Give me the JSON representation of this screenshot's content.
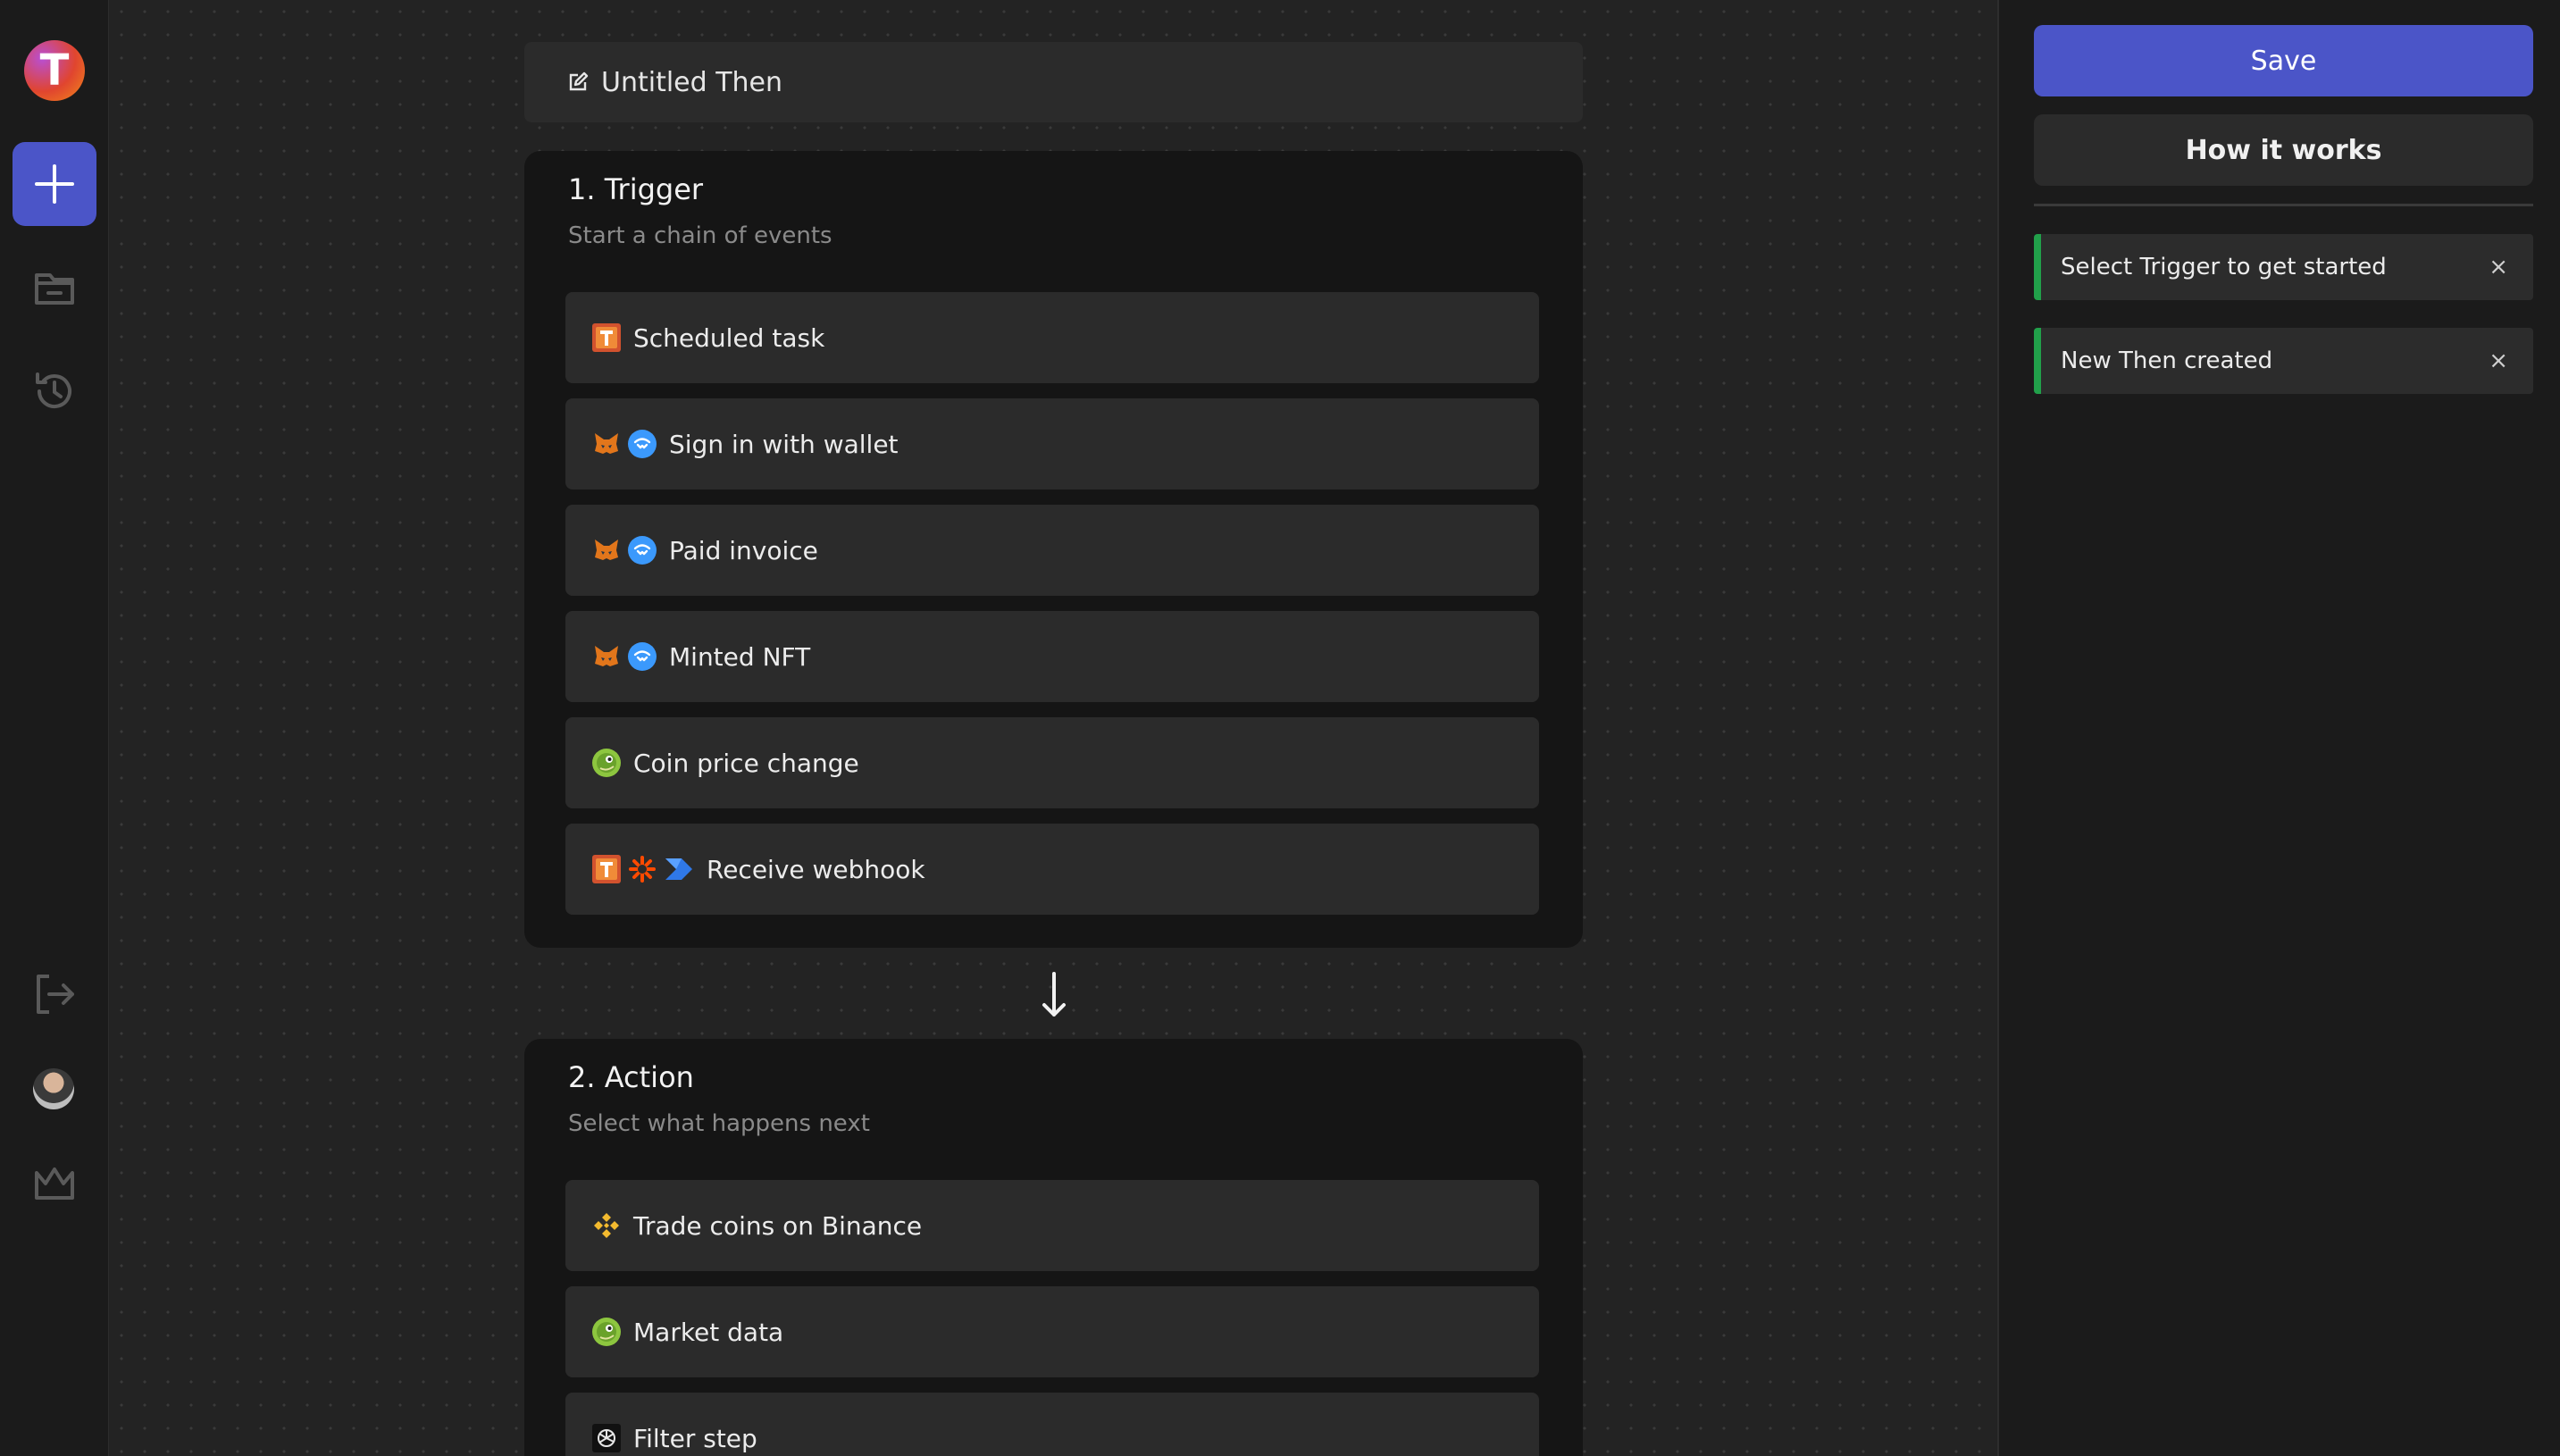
{
  "sidebar": {
    "logo_letter": "T",
    "items": [
      "add-icon",
      "folder-icon",
      "history-icon",
      "logout-icon",
      "avatar",
      "crown-icon"
    ]
  },
  "editor": {
    "title": "Untitled Then",
    "trigger": {
      "title": "1. Trigger",
      "subtitle": "Start a chain of events",
      "options": [
        {
          "label": "Scheduled task",
          "icons": [
            "then-logo"
          ]
        },
        {
          "label": "Sign in with wallet",
          "icons": [
            "metamask-fox-icon",
            "walletconnect-icon"
          ]
        },
        {
          "label": "Paid invoice",
          "icons": [
            "metamask-fox-icon",
            "walletconnect-icon"
          ]
        },
        {
          "label": "Minted NFT",
          "icons": [
            "metamask-fox-icon",
            "walletconnect-icon"
          ]
        },
        {
          "label": "Coin price change",
          "icons": [
            "coingecko-icon"
          ]
        },
        {
          "label": "Receive webhook",
          "icons": [
            "then-logo",
            "zapier-icon",
            "power-automate-icon"
          ]
        }
      ]
    },
    "action": {
      "title": "2. Action",
      "subtitle": "Select what happens next",
      "options": [
        {
          "label": "Trade coins on Binance",
          "icons": [
            "binance-icon"
          ]
        },
        {
          "label": "Market data",
          "icons": [
            "coingecko-icon"
          ]
        },
        {
          "label": "Filter step",
          "icons": [
            "openai-icon"
          ]
        }
      ]
    }
  },
  "panel": {
    "save_label": "Save",
    "how_label": "How it works",
    "toasts": [
      {
        "text": "Select Trigger to get started",
        "close": "×"
      },
      {
        "text": "New Then created",
        "close": "×"
      }
    ]
  },
  "colors": {
    "accent": "#4b55c8",
    "toast_bar": "#21a04a",
    "background": "#232323",
    "card": "#151515"
  }
}
